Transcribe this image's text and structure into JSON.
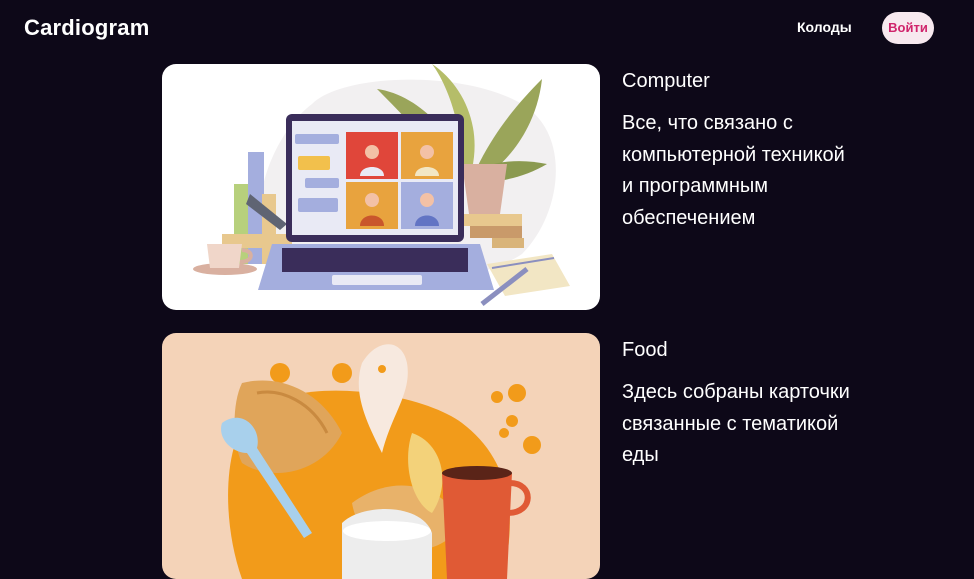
{
  "header": {
    "logo": "Cardiogram",
    "nav_decks": "Колоды",
    "login": "Войти"
  },
  "decks": [
    {
      "title": "Computer",
      "description": "Все, что связано с компьютерной техникой и программным обеспечением",
      "image": "laptop-video-call-illustration"
    },
    {
      "title": "Food",
      "description": "Здесь собраны карточки связанные с тематикой еды",
      "image": "food-illustration"
    }
  ],
  "colors": {
    "background": "#0d0818",
    "text": "#ffffff",
    "login_bg": "#f7e9ef",
    "login_text": "#d0246c",
    "card1_bg": "#ffffff",
    "card2_bg": "#f4d3b8"
  }
}
